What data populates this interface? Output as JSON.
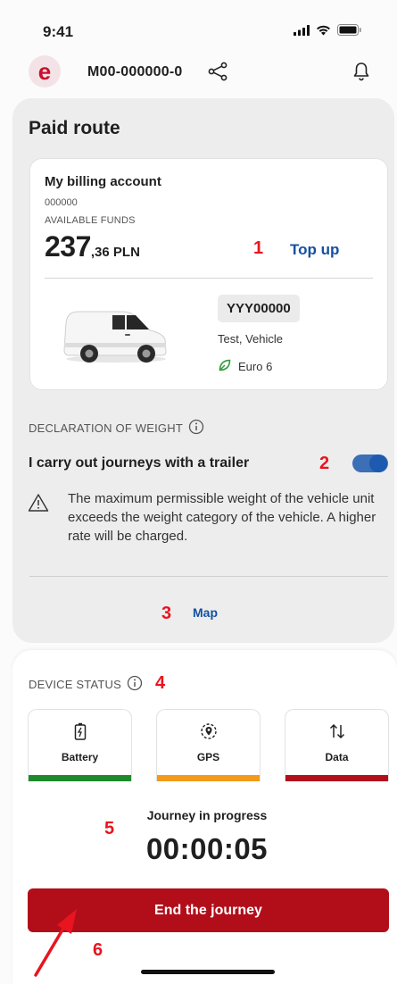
{
  "status_bar": {
    "time": "9:41",
    "icons": [
      "signal-icon",
      "wifi-icon",
      "battery-icon"
    ]
  },
  "header": {
    "logo_glyph": "e",
    "device_id": "M00-000000-0",
    "icons": [
      "share-icon",
      "bell-icon"
    ]
  },
  "route": {
    "title": "Paid route",
    "billing": {
      "title": "My billing account",
      "number": "000000",
      "funds_label": "AVAILABLE FUNDS",
      "funds_whole": "237",
      "funds_rest": ",36 PLN",
      "top_up": "Top up"
    },
    "vehicle": {
      "plate": "YYY00000",
      "name": "Test, Vehicle",
      "euro": "Euro 6"
    },
    "declaration_label": "DECLARATION OF WEIGHT",
    "trailer_text": "I carry out journeys with a trailer",
    "trailer_enabled": true,
    "warning": "The maximum permissible weight of the vehicle unit exceeds the weight category of the vehicle. A higher rate will be charged.",
    "map_link": "Map"
  },
  "device_status": {
    "label": "DEVICE STATUS",
    "tiles": [
      {
        "label": "Battery",
        "icon": "battery-charging-icon",
        "color": "#1e8a2c"
      },
      {
        "label": "GPS",
        "icon": "gps-icon",
        "color": "#f29a1a"
      },
      {
        "label": "Data",
        "icon": "data-transfer-icon",
        "color": "#b20f1d"
      }
    ],
    "journey_status": "Journey in progress",
    "timer": "00:00:05",
    "end_button": "End the journey"
  },
  "annotations": [
    "1",
    "2",
    "3",
    "4",
    "5",
    "6"
  ],
  "colors": {
    "brand_red": "#c8102e",
    "link_blue": "#1550a0",
    "button_red": "#b10e1a",
    "annotation_red": "#e8141f"
  }
}
